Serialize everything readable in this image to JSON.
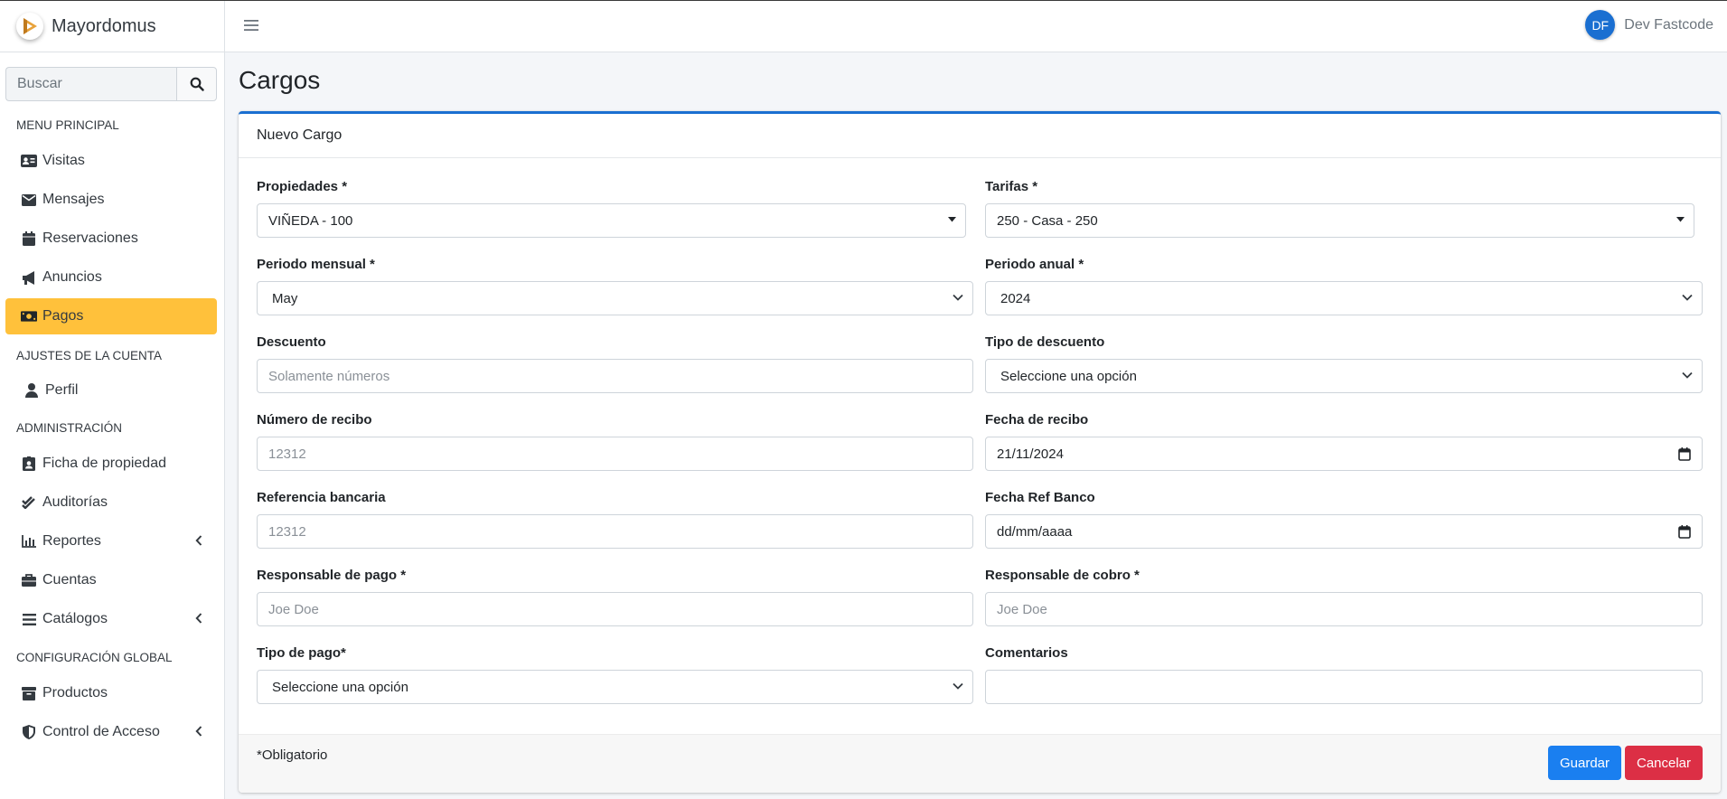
{
  "app": {
    "brand": "Mayordomus"
  },
  "search": {
    "placeholder": "Buscar"
  },
  "sidebar": {
    "sections": [
      {
        "header": "MENU PRINCIPAL"
      },
      {
        "header": "AJUSTES DE LA CUENTA"
      },
      {
        "header": "ADMINISTRACIÓN"
      },
      {
        "header": "CONFIGURACIÓN GLOBAL"
      }
    ],
    "items": [
      {
        "label": "Visitas",
        "icon": "id-card-icon"
      },
      {
        "label": "Mensajes",
        "icon": "envelope-icon"
      },
      {
        "label": "Reservaciones",
        "icon": "calendar-icon"
      },
      {
        "label": "Anuncios",
        "icon": "bullhorn-icon"
      },
      {
        "label": "Pagos",
        "icon": "money-bill-icon",
        "active": true
      },
      {
        "label": "Perfil",
        "icon": "user-icon"
      },
      {
        "label": "Ficha de propiedad",
        "icon": "id-badge-icon"
      },
      {
        "label": "Auditorías",
        "icon": "check-double-icon"
      },
      {
        "label": "Reportes",
        "icon": "chart-icon",
        "has_children": true
      },
      {
        "label": "Cuentas",
        "icon": "briefcase-icon"
      },
      {
        "label": "Catálogos",
        "icon": "list-icon",
        "has_children": true
      },
      {
        "label": "Productos",
        "icon": "box-icon"
      },
      {
        "label": "Control de Acceso",
        "icon": "shield-icon",
        "has_children": true
      }
    ]
  },
  "user": {
    "initials": "DF",
    "name": "Dev Fastcode"
  },
  "page": {
    "title": "Cargos"
  },
  "form": {
    "title": "Nuevo Cargo",
    "fields": {
      "propiedades": {
        "label": "Propiedades *",
        "value": "VIÑEDA - 100"
      },
      "tarifas": {
        "label": "Tarifas *",
        "value": "250 - Casa - 250"
      },
      "periodo_mensual": {
        "label": "Periodo mensual *",
        "value": "May"
      },
      "periodo_anual": {
        "label": "Periodo anual *",
        "value": "2024"
      },
      "descuento": {
        "label": "Descuento",
        "placeholder": "Solamente números"
      },
      "tipo_descuento": {
        "label": "Tipo de descuento",
        "value": "Seleccione una opción"
      },
      "numero_recibo": {
        "label": "Número de recibo",
        "placeholder": "12312"
      },
      "fecha_recibo": {
        "label": "Fecha de recibo",
        "value": "21/11/2024"
      },
      "referencia_bancaria": {
        "label": "Referencia bancaria",
        "placeholder": "12312"
      },
      "fecha_ref_banco": {
        "label": "Fecha Ref Banco",
        "value": "dd/mm/aaaa"
      },
      "responsable_pago": {
        "label": "Responsable de pago *",
        "placeholder": "Joe Doe"
      },
      "responsable_cobro": {
        "label": "Responsable de cobro *",
        "placeholder": "Joe Doe"
      },
      "tipo_pago": {
        "label": "Tipo de pago*",
        "value": "Seleccione una opción"
      },
      "comentarios": {
        "label": "Comentarios",
        "value": ""
      }
    },
    "footer": {
      "required_note": "*Obligatorio",
      "save_label": "Guardar",
      "cancel_label": "Cancelar"
    }
  },
  "colors": {
    "accent": "#1a6fd1",
    "active_nav": "#ffc13b",
    "save": "#1a7ff0",
    "cancel": "#dc2f45"
  }
}
